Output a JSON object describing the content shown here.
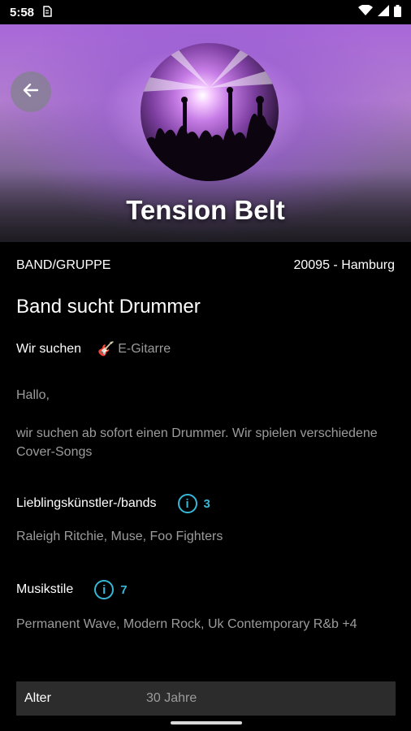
{
  "statusbar": {
    "time": "5:58",
    "sim_icon": "sim-card-icon",
    "wifi_icon": "wifi-icon",
    "signal_icon": "signal-icon",
    "battery_icon": "battery-icon"
  },
  "header": {
    "band_name": "Tension Belt",
    "back_icon": "arrow-left-icon",
    "avatar_image": "concert-crowd-photo"
  },
  "listing": {
    "type": "BAND/GRUPPE",
    "location": "20095 - Hamburg",
    "title": "Band sucht Drummer",
    "search_label": "Wir suchen",
    "instrument_icon": "guitar-icon",
    "instrument": "E-Gitarre",
    "greeting": "Hallo,",
    "description": "wir suchen ab sofort einen Drummer. Wir spielen verschiedene Cover-Songs"
  },
  "favorites": {
    "label": "Lieblingskünstler-/bands",
    "count": "3",
    "value": "Raleigh Ritchie, Muse, Foo Fighters"
  },
  "styles": {
    "label": "Musikstile",
    "count": "7",
    "value": "Permanent Wave, Modern Rock, Uk Contemporary R&b +4"
  },
  "details": {
    "age_label": "Alter",
    "age_value": "30 Jahre"
  },
  "colors": {
    "accent": "#36b8d6",
    "background": "#000000",
    "row_background": "#2c2c2c"
  }
}
